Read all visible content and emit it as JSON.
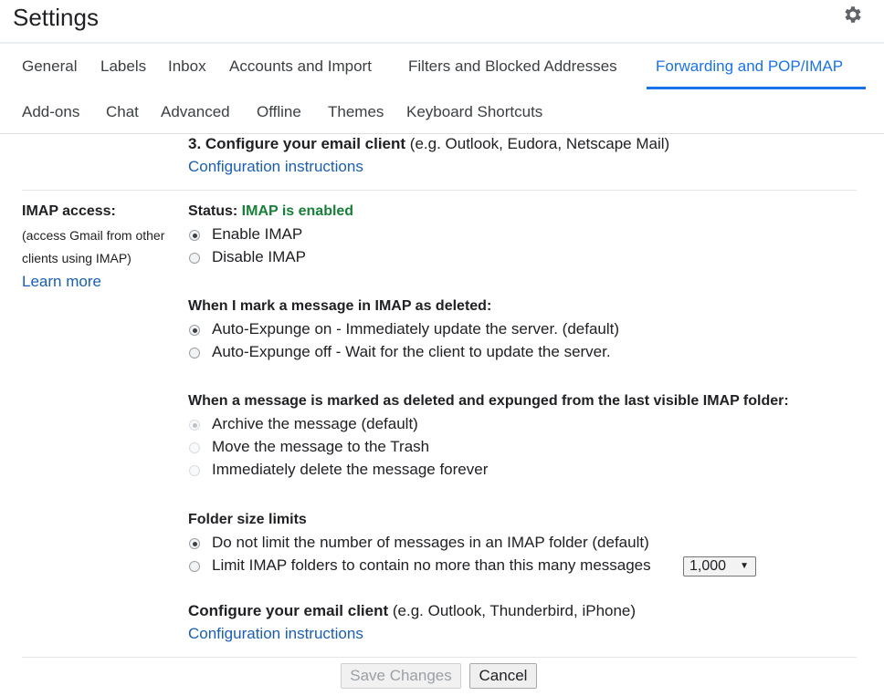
{
  "header": {
    "title": "Settings",
    "icon": "gear-icon"
  },
  "tabs": [
    {
      "label": "General",
      "active": false
    },
    {
      "label": "Labels",
      "active": false
    },
    {
      "label": "Inbox",
      "active": false
    },
    {
      "label": "Accounts and Import",
      "active": false
    },
    {
      "label": "Filters and Blocked Addresses",
      "active": false
    },
    {
      "label": "Forwarding and POP/IMAP",
      "active": true
    },
    {
      "label": "Add-ons",
      "active": false
    },
    {
      "label": "Chat",
      "active": false
    },
    {
      "label": "Advanced",
      "active": false
    },
    {
      "label": "Offline",
      "active": false
    },
    {
      "label": "Themes",
      "active": false
    },
    {
      "label": "Keyboard Shortcuts",
      "active": false
    }
  ],
  "pop_section": {
    "step_heading": "3. Configure your email client",
    "step_note": " (e.g. Outlook, Eudora, Netscape Mail)",
    "config_link": "Configuration instructions"
  },
  "imap": {
    "label": "IMAP access:",
    "desc_line1": "(access Gmail from other",
    "desc_line2": "clients using IMAP)",
    "learn_more": "Learn more",
    "status_label": "Status: ",
    "status_value": "IMAP is enabled",
    "status_color": "#188038",
    "access_options": [
      {
        "label": "Enable IMAP",
        "selected": true
      },
      {
        "label": "Disable IMAP",
        "selected": false
      }
    ],
    "deleted_heading": "When I mark a message in IMAP as deleted:",
    "deleted_options": [
      {
        "label": "Auto-Expunge on - Immediately update the server. (default)",
        "selected": true
      },
      {
        "label": "Auto-Expunge off - Wait for the client to update the server.",
        "selected": false
      }
    ],
    "expunged_heading": "When a message is marked as deleted and expunged from the last visible IMAP folder:",
    "expunged_options": [
      {
        "label": "Archive the message (default)",
        "selected": true,
        "disabled": true
      },
      {
        "label": "Move the message to the Trash",
        "selected": false,
        "disabled": true
      },
      {
        "label": "Immediately delete the message forever",
        "selected": false,
        "disabled": true
      }
    ],
    "folder_heading": "Folder size limits",
    "folder_options": [
      {
        "label": "Do not limit the number of messages in an IMAP folder (default)",
        "selected": true
      },
      {
        "label": "Limit IMAP folders to contain no more than this many messages",
        "selected": false
      }
    ],
    "folder_limit_value": "1,000",
    "client_heading": "Configure your email client",
    "client_note": " (e.g. Outlook, Thunderbird, iPhone)",
    "client_link": "Configuration instructions"
  },
  "footer": {
    "save_label": "Save Changes",
    "cancel_label": "Cancel"
  },
  "colors": {
    "accent": "#1a73e8",
    "link": "#1a5fb4"
  }
}
